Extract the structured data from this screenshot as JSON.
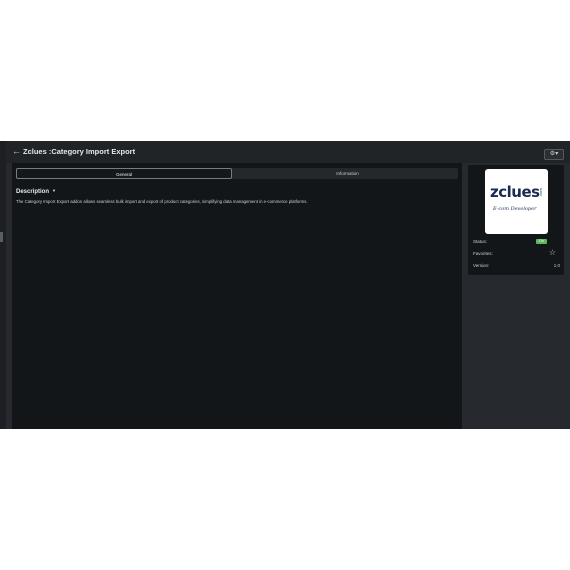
{
  "header": {
    "title": "Zclues :Category Import Export",
    "back_icon": "arrow-left-icon",
    "settings_icon": "gear-icon"
  },
  "tabs": [
    {
      "label": "General",
      "active": true
    },
    {
      "label": "Information",
      "active": false
    }
  ],
  "description": {
    "heading": "Description",
    "text": "The Category Import Export addon allows seamless bulk import and export of product categories, simplifying data management in e-commerce platforms."
  },
  "logo": {
    "brand": "zclues",
    "suffix": ".com",
    "tagline": "E-com Developer"
  },
  "info": {
    "status_label": "Status:",
    "status_value": "On",
    "favorites_label": "Favorites:",
    "version_label": "Version:",
    "version_value": "1.0"
  },
  "colors": {
    "status_on": "#5cb85c",
    "logo_text": "#1a2a52"
  }
}
